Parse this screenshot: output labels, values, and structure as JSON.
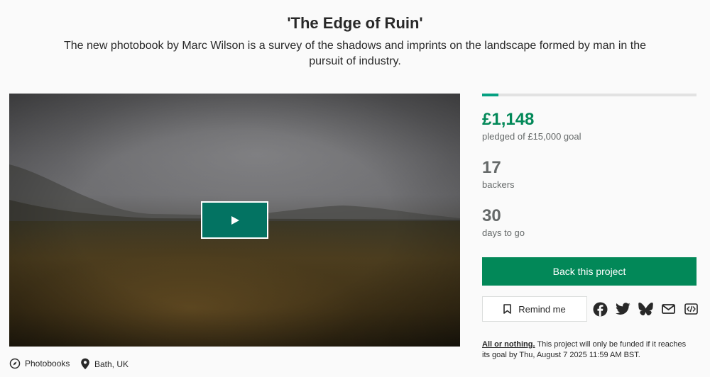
{
  "project": {
    "title": "'The Edge of Ruin'",
    "blurb": "The new photobook by Marc Wilson is a survey of the shadows and imprints on the landscape formed by man in the pursuit of industry."
  },
  "media": {
    "play_label": "Play video"
  },
  "meta": {
    "category": "Photobooks",
    "location": "Bath, UK"
  },
  "funding": {
    "progress_fraction": 0.0765,
    "pledged": "£1,148",
    "pledged_label": "pledged of £15,000 goal",
    "backers": "17",
    "backers_label": "backers",
    "days": "30",
    "days_label": "days to go"
  },
  "actions": {
    "back_label": "Back this project",
    "remind_label": "Remind me"
  },
  "share": [
    "facebook-icon",
    "twitter-icon",
    "bluesky-icon",
    "email-icon",
    "embed-icon"
  ],
  "fine_print": {
    "lead": "All or nothing.",
    "text": " This project will only be funded if it reaches its goal by Thu, August 7 2025 11:59 AM BST."
  },
  "colors": {
    "accent": "#028858",
    "progress": "#05a081",
    "muted": "#656969"
  }
}
